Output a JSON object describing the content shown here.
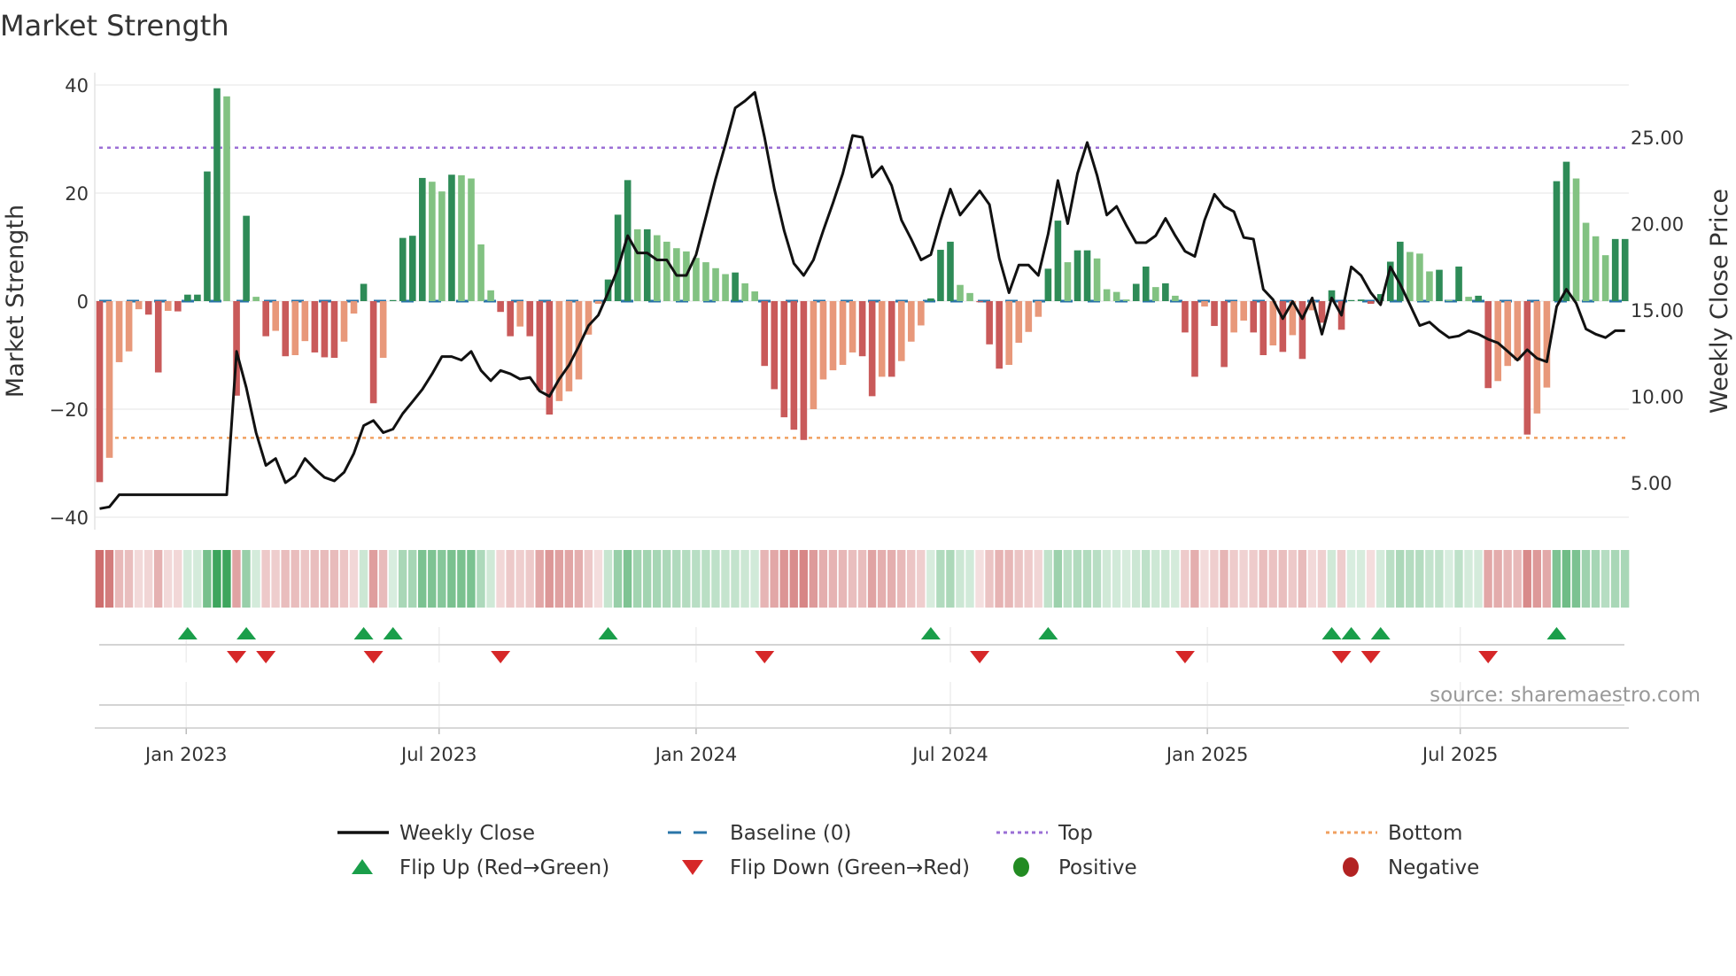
{
  "chart_data": {
    "type": "bar",
    "title": "Market Strength",
    "ylabel": "Market Strength",
    "y2label": "Weekly Close Price",
    "ylim": [
      -40,
      40
    ],
    "y2lim": [
      2.1,
      29.4
    ],
    "yticks": [
      "40",
      "20",
      "0",
      "−20",
      "−40"
    ],
    "ytick_values": [
      40,
      20,
      0,
      -20,
      -40
    ],
    "y2ticks": [
      "25.00",
      "20.00",
      "15.00",
      "10.00",
      "5.00"
    ],
    "y2tick_values": [
      25,
      20,
      15,
      10,
      5
    ],
    "xticks": [
      {
        "label": "Jan 2023",
        "date": "2023-01-01"
      },
      {
        "label": "Jul 2023",
        "date": "2023-07-01"
      },
      {
        "label": "Jan 2024",
        "date": "2024-01-01"
      },
      {
        "label": "Jul 2024",
        "date": "2024-07-01"
      },
      {
        "label": "Jan 2025",
        "date": "2025-01-01"
      },
      {
        "label": "Jul 2025",
        "date": "2025-07-01"
      }
    ],
    "start_date": "2022-10-31",
    "interval_days": 7,
    "top_level": 28.4,
    "bottom_level": -25.3,
    "baseline": 0,
    "strength": [
      -33.5,
      -29,
      -11.3,
      -9.3,
      -1.5,
      -2.5,
      -13.2,
      -1.8,
      -1.9,
      1.2,
      1.2,
      24,
      39.4,
      37.9,
      -17.5,
      15.8,
      0.8,
      -6.5,
      -5.5,
      -10.2,
      -10,
      -7.4,
      -9.5,
      -10.4,
      -10.5,
      -7.5,
      -2.3,
      3.2,
      -18.9,
      -10.5,
      0.2,
      11.7,
      12.1,
      22.8,
      22.1,
      20.3,
      23.4,
      23.3,
      22.7,
      10.5,
      2,
      -2,
      -6.5,
      -4.7,
      -6.5,
      -16.5,
      -21,
      -18.5,
      -16.7,
      -14.5,
      -6.2,
      -0.5,
      4,
      16,
      22.4,
      13.3,
      13.3,
      12.2,
      11,
      9.8,
      9.2,
      8,
      7.2,
      6.1,
      5,
      5.3,
      3.3,
      1.8,
      -12,
      -16.3,
      -21.5,
      -23.8,
      -25.7,
      -20,
      -14.5,
      -12.8,
      -11.8,
      -9.5,
      -10.2,
      -17.6,
      -14,
      -14,
      -11.1,
      -7.5,
      -4.5,
      0.5,
      9.5,
      11,
      3,
      1.5,
      -0.2,
      -8,
      -12.5,
      -11.8,
      -7.7,
      -5.7,
      -2.9,
      6,
      14.9,
      7.2,
      9.4,
      9.4,
      7.9,
      2.2,
      1.7,
      0.3,
      3.2,
      6.4,
      2.6,
      3.3,
      1,
      -5.8,
      -14,
      -1,
      -4.6,
      -12.2,
      -5.8,
      -3.6,
      -5.8,
      -10,
      -8.2,
      -9.4,
      -6.3,
      -10.7,
      -1.7,
      -4,
      2,
      -5.3,
      0.2,
      0.3,
      -0.5,
      1.3,
      7.3,
      11,
      9.1,
      8.8,
      5.5,
      5.8,
      0.2,
      6.4,
      0.8,
      1,
      -16.1,
      -14.8,
      -12,
      -11,
      -24.7,
      -20.8,
      -16,
      22.2,
      25.8,
      22.7,
      14.5,
      12,
      8.5,
      11.5,
      11.5
    ],
    "weekly_close": [
      3.5,
      3.6,
      4.3,
      4.3,
      4.3,
      4.3,
      4.3,
      4.3,
      4.3,
      4.3,
      4.3,
      4.3,
      4.3,
      4.3,
      12.6,
      10.5,
      7.9,
      6.0,
      6.4,
      5.0,
      5.4,
      6.4,
      5.8,
      5.3,
      5.1,
      5.6,
      6.7,
      8.3,
      8.6,
      7.9,
      8.1,
      9.0,
      9.7,
      10.4,
      11.3,
      12.3,
      12.3,
      12.1,
      12.6,
      11.5,
      10.9,
      11.5,
      11.3,
      11.0,
      11.1,
      10.3,
      10.0,
      11.0,
      11.8,
      12.9,
      14.1,
      14.7,
      16.0,
      17.4,
      19.3,
      18.3,
      18.3,
      17.9,
      17.9,
      17.0,
      17.0,
      18.2,
      20.4,
      22.6,
      24.6,
      26.7,
      27.1,
      27.6,
      25.0,
      22.0,
      19.6,
      17.7,
      17.0,
      17.9,
      19.6,
      21.2,
      22.9,
      25.1,
      25.0,
      22.7,
      23.3,
      22.2,
      20.2,
      19.1,
      17.9,
      18.2,
      20.2,
      22.0,
      20.5,
      21.2,
      21.9,
      21.1,
      18.0,
      16.0,
      17.6,
      17.6,
      17.0,
      19.4,
      22.5,
      20.0,
      22.9,
      24.7,
      22.8,
      20.5,
      21.0,
      19.9,
      18.9,
      18.9,
      19.3,
      20.3,
      19.3,
      18.4,
      18.1,
      20.2,
      21.7,
      21.0,
      20.7,
      19.2,
      19.1,
      16.2,
      15.6,
      14.5,
      15.5,
      14.5,
      15.7,
      13.6,
      15.7,
      14.7,
      17.5,
      17.0,
      16.0,
      15.3,
      17.5,
      16.5,
      15.3,
      14.1,
      14.3,
      13.8,
      13.4,
      13.5,
      13.8,
      13.6,
      13.3,
      13.1,
      12.6,
      12.1,
      12.7,
      12.2,
      12.0,
      15.2,
      16.2,
      15.4,
      13.9,
      13.6,
      13.4,
      13.8,
      13.8
    ],
    "flip_up_dates": [
      "2023-01-02",
      "2023-02-13",
      "2023-05-08",
      "2023-05-29",
      "2023-10-30",
      "2024-06-17",
      "2024-09-09",
      "2025-03-31",
      "2025-04-14",
      "2025-05-05",
      "2025-09-08"
    ],
    "flip_down_dates": [
      "2023-02-06",
      "2023-02-27",
      "2023-05-15",
      "2023-08-14",
      "2024-02-19",
      "2024-07-22",
      "2024-12-16",
      "2025-04-07",
      "2025-04-28",
      "2025-07-21"
    ],
    "legend": {
      "placement": "bottom",
      "items": [
        {
          "key": "close",
          "label": "Weekly Close"
        },
        {
          "key": "baseline",
          "label": "Baseline (0)"
        },
        {
          "key": "top",
          "label": "Top"
        },
        {
          "key": "bottom",
          "label": "Bottom"
        },
        {
          "key": "flip_up",
          "label": "Flip Up (Red→Green)"
        },
        {
          "key": "flip_down",
          "label": "Flip Down (Green→Red)"
        },
        {
          "key": "positive",
          "label": "Positive"
        },
        {
          "key": "negative",
          "label": "Negative"
        }
      ]
    },
    "source": "source: sharemaestro.com",
    "colors": {
      "pos_rising": "#2e8b57",
      "pos_falling": "#82c282",
      "neg_falling": "#c95a5a",
      "neg_rising": "#e8987a",
      "close": "#111111",
      "baseline": "#2a75a8",
      "top": "#9b6fd6",
      "bottom": "#f0a060",
      "flip_up": "#1a9e4a",
      "flip_down": "#d62728",
      "positive": "#228b22",
      "negative": "#b22222"
    }
  }
}
